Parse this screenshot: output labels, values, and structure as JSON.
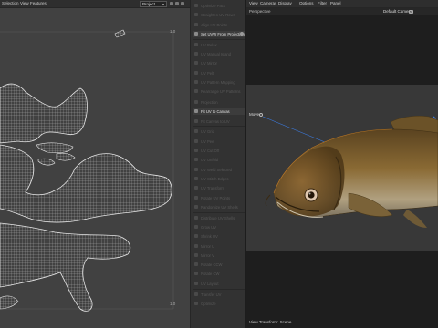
{
  "uv_editor": {
    "menu": [
      "Selection",
      "View",
      "Features"
    ],
    "dropdown_value": "Project",
    "corner_top_right": "1.0",
    "corner_bottom_right": "1.0"
  },
  "tools": {
    "items": [
      {
        "label": "Optimize Pack",
        "active": false
      },
      {
        "label": "Straighten UV Rows",
        "active": false
      },
      {
        "label": "Align UV Points",
        "active": false
      },
      {
        "label": "Set UVW From Projection",
        "active": true,
        "gear": true
      },
      {
        "label": "UV Relax",
        "active": false
      },
      {
        "label": "UV Manual Island",
        "active": false
      },
      {
        "label": "UV Mirror",
        "active": false
      },
      {
        "label": "UV Pelt",
        "active": false
      },
      {
        "label": "UV Pattern Mapping",
        "active": false
      },
      {
        "label": "Rearrange UV Patterns",
        "active": false
      },
      {
        "label": "Projection",
        "active": false
      },
      {
        "label": "Fit UV to Canvas",
        "active": true
      },
      {
        "label": "Fit Canvas to UV",
        "active": false
      },
      {
        "label": "UV Grid",
        "active": false
      },
      {
        "label": "UV Peel",
        "active": false
      },
      {
        "label": "UV Cut Off",
        "active": false
      },
      {
        "label": "UV Unfold",
        "active": false
      },
      {
        "label": "UV Weld Selected",
        "active": false
      },
      {
        "label": "UV Stitch Edges",
        "active": false
      },
      {
        "label": "UV Transform",
        "active": false
      },
      {
        "label": "Rotate UV Points",
        "active": false
      },
      {
        "label": "Randomize UV Shells",
        "active": false
      },
      {
        "label": "Distribute UV Shells",
        "active": false
      },
      {
        "label": "Grow UV",
        "active": false
      },
      {
        "label": "Shrink UV",
        "active": false
      },
      {
        "label": "Mirror U",
        "active": false
      },
      {
        "label": "Mirror V",
        "active": false
      },
      {
        "label": "Rotate CCW",
        "active": false
      },
      {
        "label": "Rotate CW",
        "active": false
      },
      {
        "label": "UV Layout",
        "active": false
      },
      {
        "label": "Transfer UV",
        "active": false
      },
      {
        "label": "Optimize",
        "active": false
      }
    ]
  },
  "viewport": {
    "menu": [
      "View",
      "Cameras",
      "Display",
      "Options",
      "Filter",
      "Panel"
    ],
    "projection": "Perspective",
    "camera": "Default Camera",
    "move_label": "Move",
    "status": "View Transform: Scene"
  },
  "colors": {
    "active_tool_text": "#e0e0e0",
    "inactive_tool_text": "#585858",
    "mesh_line": "#d8d8d8",
    "axis_blue": "#3c7be0",
    "fish_body": "#7a5a2c"
  }
}
